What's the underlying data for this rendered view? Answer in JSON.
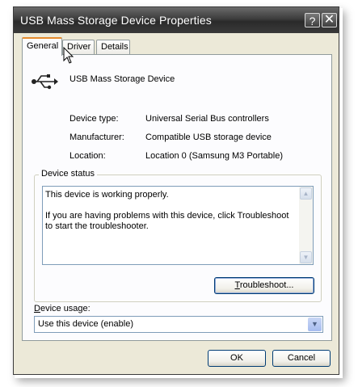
{
  "window": {
    "title": "USB Mass Storage Device Properties",
    "help_glyph": "?",
    "close_glyph": "✕"
  },
  "tabs": [
    {
      "label": "General",
      "active": true
    },
    {
      "label": "Driver",
      "active": false
    },
    {
      "label": "Details",
      "active": false
    }
  ],
  "device": {
    "name": "USB Mass Storage Device",
    "icon": "usb-icon"
  },
  "properties": [
    {
      "label": "Device type:",
      "value": "Universal Serial Bus controllers"
    },
    {
      "label": "Manufacturer:",
      "value": "Compatible USB storage device"
    },
    {
      "label": "Location:",
      "value": "Location 0 (Samsung M3 Portable)"
    }
  ],
  "status": {
    "group_title": "Device status",
    "line1": "This device is working properly.",
    "line2": "If you are having problems with this device, click Troubleshoot to start the troubleshooter."
  },
  "buttons": {
    "troubleshoot_pre": "",
    "troubleshoot_mnemonic": "T",
    "troubleshoot_post": "roubleshoot...",
    "ok": "OK",
    "cancel": "Cancel"
  },
  "usage": {
    "label_mnemonic": "D",
    "label_rest": "evice usage:",
    "selected": "Use this device (enable)"
  },
  "colors": {
    "dialog_bg": "#ece9d8",
    "panel_bg": "#fcfcfe",
    "active_tab_accent": "#e68b2c",
    "field_border": "#7f9db9"
  }
}
